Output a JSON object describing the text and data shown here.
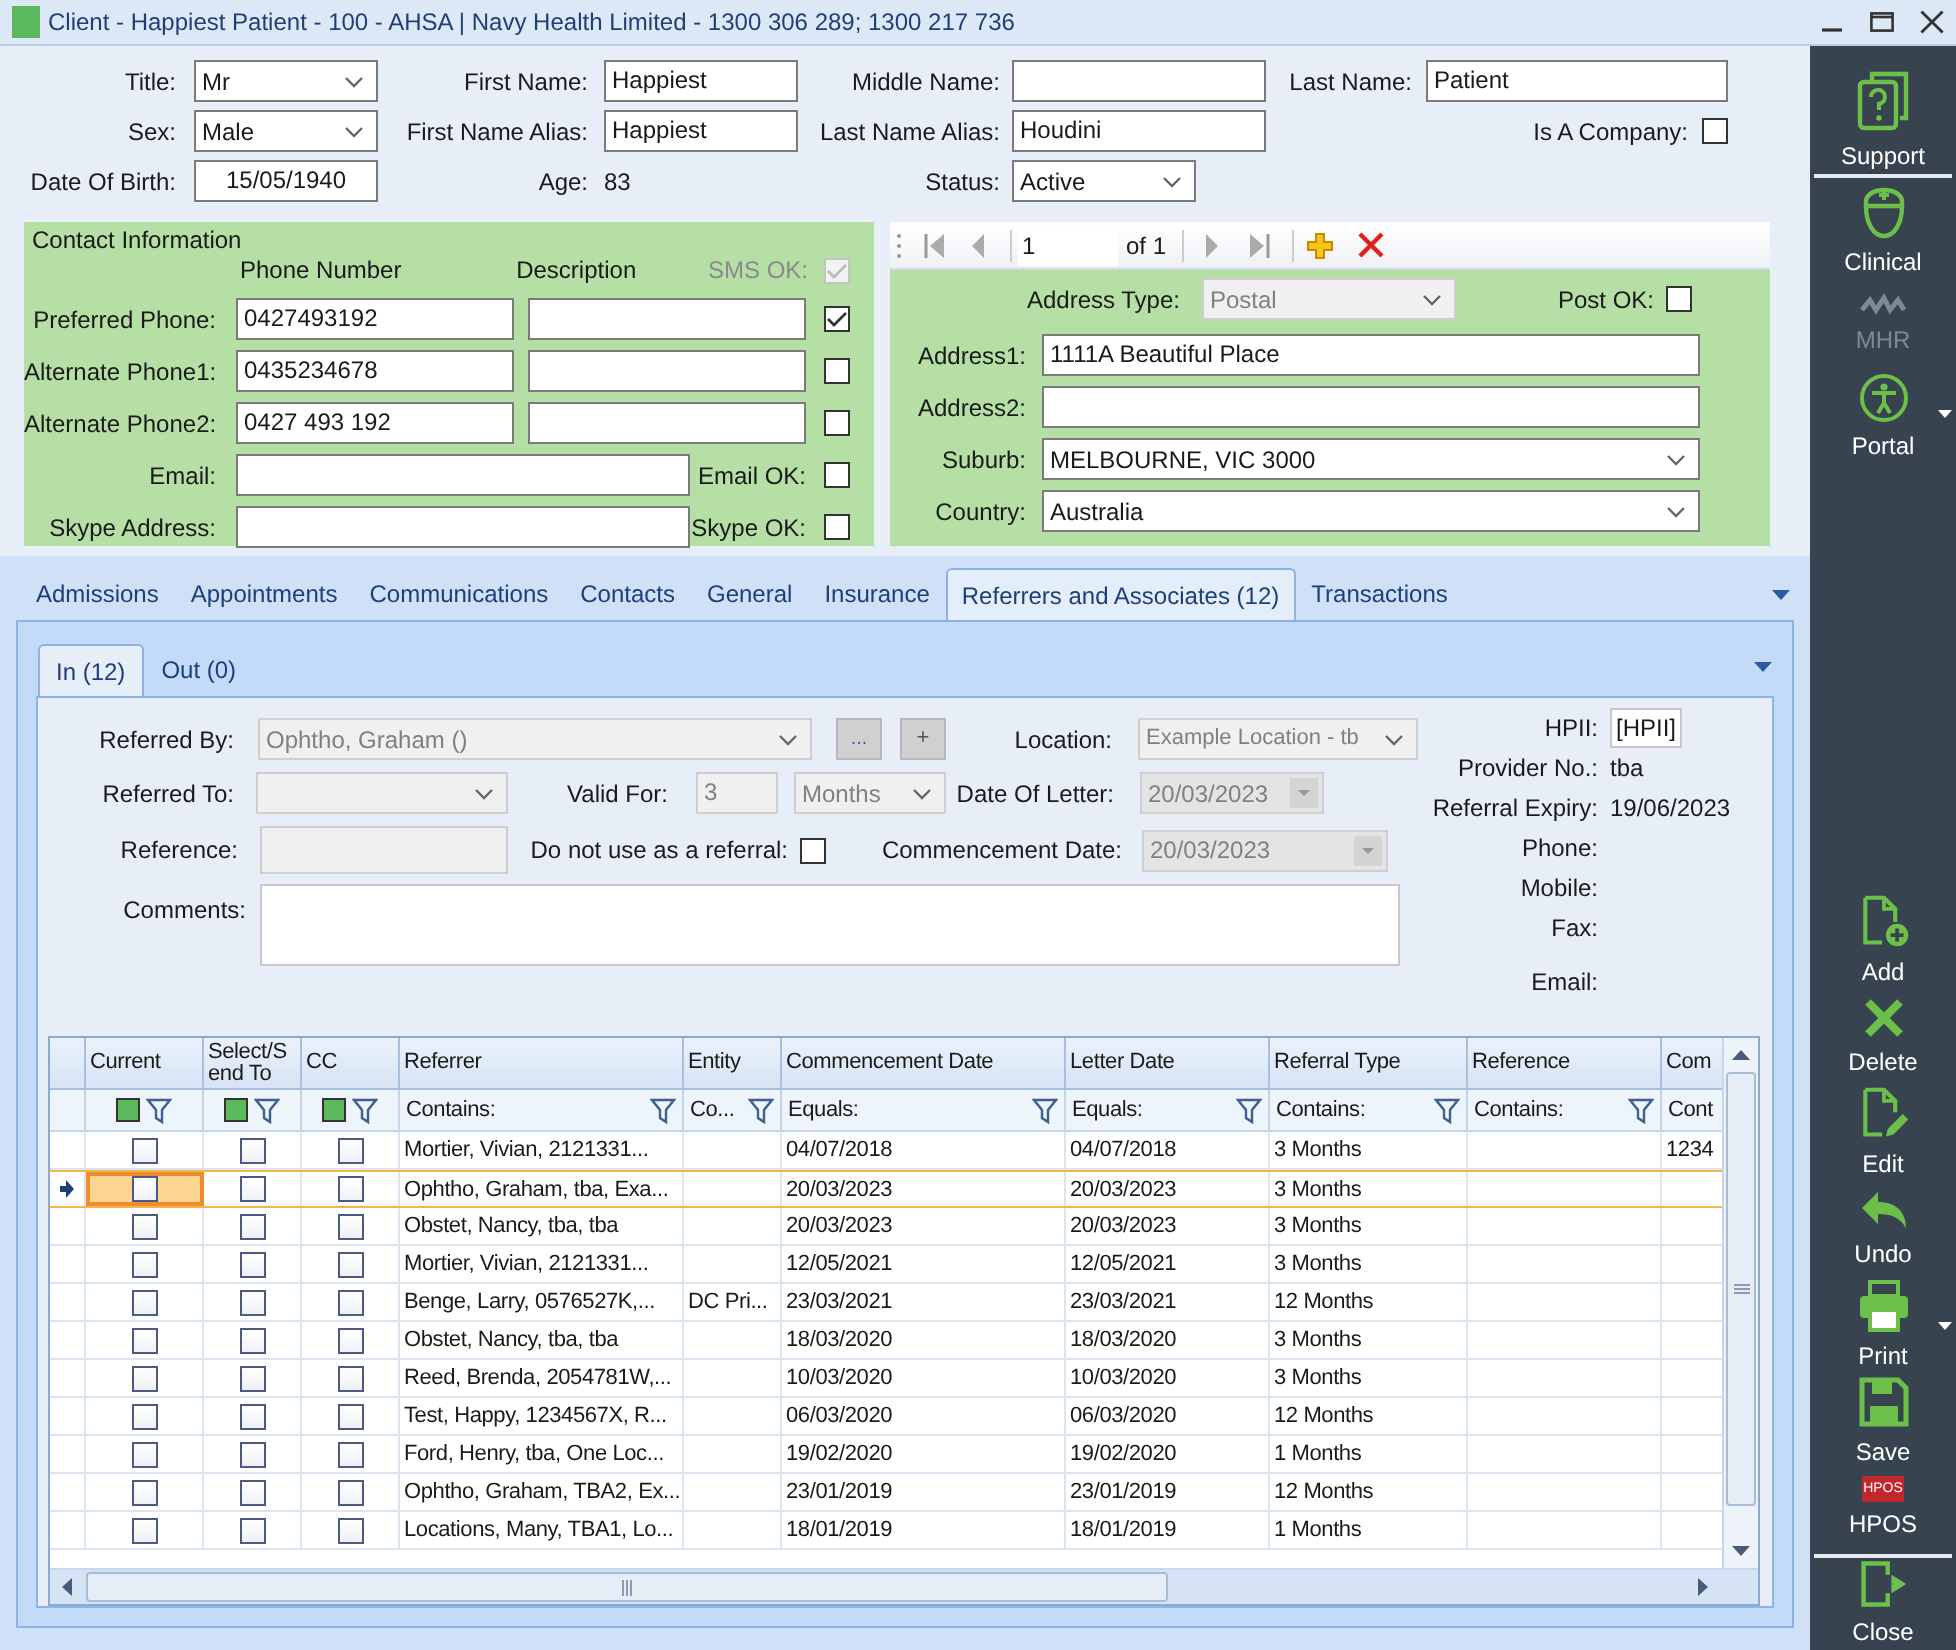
{
  "window": {
    "title": "Client - Happiest Patient - 100 - AHSA | Navy Health Limited - 1300 306 289; 1300 217 736"
  },
  "person_rows": [
    {
      "fields": [
        {
          "label": "Title:",
          "kind": "select",
          "value": "Mr"
        },
        {
          "label": "First Name:",
          "kind": "input",
          "value": "Happiest"
        },
        {
          "label": "Middle Name:",
          "kind": "input"
        },
        {
          "label": "Last Name:",
          "kind": "input",
          "value": "Patient"
        }
      ]
    },
    {
      "fields": [
        {
          "label": "Sex:",
          "kind": "select",
          "value": "Male"
        },
        {
          "label": "First Name Alias:",
          "kind": "input",
          "value": "Happiest"
        },
        {
          "label": "Last Name Alias:",
          "kind": "input",
          "value": "Houdini"
        },
        {
          "label": "Is A Company:",
          "kind": "checkbox",
          "checked": false
        }
      ]
    },
    {
      "fields": [
        {
          "label": "Date Of Birth:",
          "kind": "date",
          "value": "15/05/1940"
        },
        {
          "label": "Age:",
          "kind": "text",
          "value": "83"
        },
        {
          "label": "Status:",
          "kind": "select",
          "value": "Active"
        }
      ]
    }
  ],
  "contact": {
    "heading": "Contact Information",
    "columns": [
      "Phone Number",
      "Description"
    ],
    "sms_label": "SMS OK:",
    "sms_all": {
      "checked": true,
      "disabled": true
    },
    "phones": [
      {
        "label": "Preferred Phone:",
        "number": "0427493192",
        "sms_ok": true
      },
      {
        "label": "Alternate Phone1:",
        "number": "0435234678",
        "sms_ok": false
      },
      {
        "label": "Alternate Phone2:",
        "number": "0427 493 192",
        "sms_ok": false
      }
    ],
    "others": [
      {
        "label": "Email:",
        "ok_label": "Email OK:",
        "ok": false
      },
      {
        "label": "Skype Address:",
        "ok_label": "Skype OK:",
        "ok": false
      }
    ]
  },
  "address": {
    "pager": {
      "page": "1",
      "total": "of 1"
    },
    "type_label": "Address Type:",
    "type": {
      "value": "Postal",
      "disabled": true
    },
    "post_ok_label": "Post OK:",
    "post_ok": false,
    "fields": [
      {
        "label": "Address1:",
        "kind": "input",
        "value": "1111A Beautiful Place"
      },
      {
        "label": "Address2:",
        "kind": "input"
      },
      {
        "label": "Suburb:",
        "kind": "select",
        "value": "MELBOURNE, VIC 3000"
      },
      {
        "label": "Country:",
        "kind": "select",
        "value": "Australia"
      }
    ]
  },
  "tabs": [
    {
      "label": "Admissions",
      "selected": false
    },
    {
      "label": "Appointments",
      "selected": false
    },
    {
      "label": "Communications",
      "selected": false
    },
    {
      "label": "Contacts",
      "selected": false
    },
    {
      "label": "General",
      "selected": false
    },
    {
      "label": "Insurance",
      "selected": false
    },
    {
      "label": "Referrers and Associates (12)",
      "selected": true
    },
    {
      "label": "Transactions",
      "selected": false
    }
  ],
  "subtabs": [
    {
      "label": "In (12)",
      "selected": true
    },
    {
      "label": "Out (0)",
      "selected": false
    }
  ],
  "referral": {
    "referred_by": {
      "label": "Referred By:",
      "value": "Ophtho, Graham ()"
    },
    "browse_button": "...",
    "add_button": "+",
    "location": {
      "label": "Location:",
      "value": "Example Location - tb"
    },
    "referred_to": {
      "label": "Referred To:"
    },
    "valid_for": {
      "label": "Valid For:",
      "value": "3",
      "unit": "Months"
    },
    "date_of_letter": {
      "label": "Date Of Letter:",
      "value": "20/03/2023"
    },
    "reference": {
      "label": "Reference:"
    },
    "do_not_use": {
      "label": "Do not use as a referral:",
      "checked": false
    },
    "commencement": {
      "label": "Commencement Date:",
      "value": "20/03/2023"
    },
    "comments": {
      "label": "Comments:"
    }
  },
  "provider_info": [
    {
      "label": "HPII:",
      "kind": "box",
      "value": "[HPII]"
    },
    {
      "label": "Provider No.:",
      "kind": "text",
      "value": "tba"
    },
    {
      "label": "Referral Expiry:",
      "kind": "text",
      "value": "19/06/2023"
    },
    {
      "label": "Phone:",
      "kind": "text"
    },
    {
      "label": "Mobile:",
      "kind": "text"
    },
    {
      "label": "Fax:",
      "kind": "text"
    },
    {
      "label": "Email:",
      "kind": "text"
    }
  ],
  "grid": {
    "columns": [
      {
        "label": "Current",
        "kind": "check",
        "filter_checked": true
      },
      {
        "label": "Select/Send To",
        "kind": "check",
        "filter_checked": true
      },
      {
        "label": "CC",
        "kind": "check",
        "filter_checked": true
      },
      {
        "label": "Referrer",
        "kind": "text",
        "filter": "Contains:"
      },
      {
        "label": "Entity",
        "kind": "text",
        "filter": "Co..."
      },
      {
        "label": "Commencement Date",
        "kind": "text",
        "filter": "Equals:"
      },
      {
        "label": "Letter Date",
        "kind": "text",
        "filter": "Equals:"
      },
      {
        "label": "Referral Type",
        "kind": "text",
        "filter": "Contains:"
      },
      {
        "label": "Reference",
        "kind": "text",
        "filter": "Contains:"
      },
      {
        "label": "Com",
        "kind": "text",
        "filter": "Cont"
      }
    ],
    "rows": [
      {
        "selected": false,
        "current": false,
        "send_to": false,
        "cc": false,
        "referrer": "Mortier, Vivian, 2121331...",
        "commencement": "04/07/2018",
        "letter_date": "04/07/2018",
        "referral_type": "3 Months",
        "comments": "1234"
      },
      {
        "selected": true,
        "current": false,
        "send_to": false,
        "cc": false,
        "referrer": "Ophtho, Graham, tba, Exa...",
        "commencement": "20/03/2023",
        "letter_date": "20/03/2023",
        "referral_type": "3 Months"
      },
      {
        "selected": false,
        "current": false,
        "send_to": false,
        "cc": false,
        "referrer": "Obstet, Nancy, tba, tba",
        "commencement": "20/03/2023",
        "letter_date": "20/03/2023",
        "referral_type": "3 Months"
      },
      {
        "selected": false,
        "current": false,
        "send_to": false,
        "cc": false,
        "referrer": "Mortier, Vivian, 2121331...",
        "commencement": "12/05/2021",
        "letter_date": "12/05/2021",
        "referral_type": "3 Months"
      },
      {
        "selected": false,
        "current": false,
        "send_to": false,
        "cc": false,
        "referrer": "Benge, Larry, 0576527K,...",
        "entity": "DC Pri...",
        "commencement": "23/03/2021",
        "letter_date": "23/03/2021",
        "referral_type": "12 Months"
      },
      {
        "selected": false,
        "current": false,
        "send_to": false,
        "cc": false,
        "referrer": "Obstet, Nancy, tba, tba",
        "commencement": "18/03/2020",
        "letter_date": "18/03/2020",
        "referral_type": "3 Months"
      },
      {
        "selected": false,
        "current": false,
        "send_to": false,
        "cc": false,
        "referrer": "Reed, Brenda, 2054781W,...",
        "commencement": "10/03/2020",
        "letter_date": "10/03/2020",
        "referral_type": "3 Months"
      },
      {
        "selected": false,
        "current": false,
        "send_to": false,
        "cc": false,
        "referrer": "Test, Happy, 1234567X, R...",
        "commencement": "06/03/2020",
        "letter_date": "06/03/2020",
        "referral_type": "12 Months"
      },
      {
        "selected": false,
        "current": false,
        "send_to": false,
        "cc": false,
        "referrer": "Ford, Henry, tba, One Loc...",
        "commencement": "19/02/2020",
        "letter_date": "19/02/2020",
        "referral_type": "1 Months"
      },
      {
        "selected": false,
        "current": false,
        "send_to": false,
        "cc": false,
        "referrer": "Ophtho, Graham, TBA2, Ex...",
        "commencement": "23/01/2019",
        "letter_date": "23/01/2019",
        "referral_type": "12 Months"
      },
      {
        "selected": false,
        "current": false,
        "send_to": false,
        "cc": false,
        "referrer": "Locations, Many, TBA1, Lo...",
        "commencement": "18/01/2019",
        "letter_date": "18/01/2019",
        "referral_type": "1 Months"
      }
    ]
  },
  "sidebar": {
    "top": [
      {
        "label": "Support",
        "disabled": false,
        "menu": false
      },
      {
        "label": "Clinical",
        "disabled": false,
        "menu": false
      },
      {
        "label": "MHR",
        "disabled": true,
        "menu": false
      },
      {
        "label": "Portal",
        "disabled": false,
        "menu": true
      }
    ],
    "actions": [
      {
        "label": "Add",
        "disabled": false,
        "menu": false
      },
      {
        "label": "Delete",
        "disabled": false,
        "menu": false
      },
      {
        "label": "Edit",
        "disabled": false,
        "menu": false
      },
      {
        "label": "Undo",
        "disabled": false,
        "menu": false
      },
      {
        "label": "Print",
        "disabled": false,
        "menu": true
      },
      {
        "label": "Save",
        "disabled": false,
        "menu": false
      },
      {
        "label": "HPOS",
        "badge": "HPOS",
        "disabled": false,
        "menu": false
      }
    ],
    "close": {
      "label": "Close"
    }
  }
}
